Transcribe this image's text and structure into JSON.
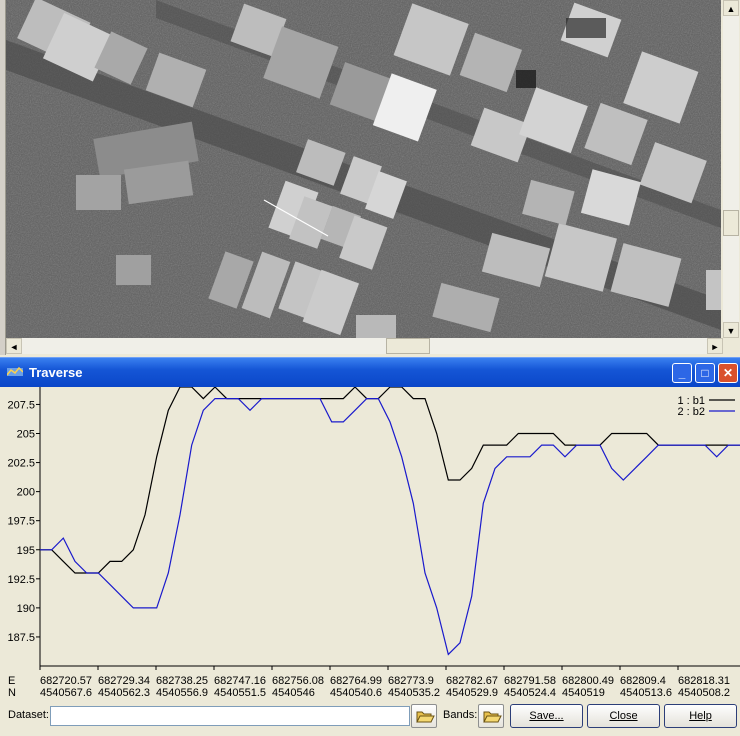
{
  "window": {
    "title": "Traverse",
    "minimize_label": "_",
    "maximize_label": "□",
    "close_label": "✕"
  },
  "image_viewer": {
    "icon_up": "▲",
    "icon_down": "▼",
    "icon_left": "◄",
    "icon_right": "►"
  },
  "legend": [
    {
      "label": "1 : b1",
      "color": "#000000"
    },
    {
      "label": "2 : b2",
      "color": "#1a1acc"
    }
  ],
  "chart_data": {
    "type": "line",
    "ylim": [
      185,
      209
    ],
    "y_ticks": [
      "207.5",
      "205",
      "202.5",
      "200",
      "197.5",
      "195",
      "192.5",
      "190",
      "187.5"
    ],
    "x_axis_rows": [
      "E",
      "N"
    ],
    "x_ticks": [
      {
        "e": "682720.57",
        "n": "4540567.6"
      },
      {
        "e": "682729.34",
        "n": "4540562.3"
      },
      {
        "e": "682738.25",
        "n": "4540556.9"
      },
      {
        "e": "682747.16",
        "n": "4540551.5"
      },
      {
        "e": "682756.08",
        "n": "4540546"
      },
      {
        "e": "682764.99",
        "n": "4540540.6"
      },
      {
        "e": "682773.9",
        "n": "4540535.2"
      },
      {
        "e": "682782.67",
        "n": "4540529.9"
      },
      {
        "e": "682791.58",
        "n": "4540524.4"
      },
      {
        "e": "682800.49",
        "n": "4540519"
      },
      {
        "e": "682809.4",
        "n": "4540513.6"
      },
      {
        "e": "682818.31",
        "n": "4540508.2"
      }
    ],
    "series": [
      {
        "name": "1 : b1",
        "x": [
          0,
          2,
          4,
          6,
          8,
          10,
          12,
          14,
          16,
          18,
          20,
          22,
          24,
          26,
          28,
          30,
          32,
          34,
          36,
          38,
          40,
          42,
          44,
          46,
          48,
          50,
          52,
          54,
          56,
          58,
          60,
          62,
          64,
          66,
          68,
          70,
          72,
          74,
          76,
          78,
          80,
          82,
          84,
          86,
          88,
          90,
          92,
          94,
          96,
          98,
          100,
          102,
          104,
          106,
          108,
          110,
          112,
          114,
          116,
          118,
          120
        ],
        "y": [
          195,
          195,
          194,
          193,
          193,
          193,
          194,
          194,
          195,
          198,
          203,
          207,
          209,
          209,
          208,
          209,
          208,
          208,
          208,
          208,
          208,
          208,
          208,
          208,
          208,
          208,
          208,
          209,
          208,
          208,
          209,
          209,
          208,
          208,
          205,
          201,
          201,
          202,
          204,
          204,
          204,
          205,
          205,
          205,
          205,
          204,
          204,
          204,
          204,
          205,
          205,
          205,
          205,
          204,
          204,
          204,
          204,
          204,
          204,
          204,
          204
        ]
      },
      {
        "name": "2 : b2",
        "x": [
          0,
          2,
          4,
          6,
          8,
          10,
          12,
          14,
          16,
          18,
          20,
          22,
          24,
          26,
          28,
          30,
          32,
          34,
          36,
          38,
          40,
          42,
          44,
          46,
          48,
          50,
          52,
          54,
          56,
          58,
          60,
          62,
          64,
          66,
          68,
          70,
          72,
          74,
          76,
          78,
          80,
          82,
          84,
          86,
          88,
          90,
          92,
          94,
          96,
          98,
          100,
          102,
          104,
          106,
          108,
          110,
          112,
          114,
          116,
          118,
          120
        ],
        "y": [
          195,
          195,
          196,
          194,
          193,
          193,
          192,
          191,
          190,
          190,
          190,
          193,
          198,
          204,
          207,
          208,
          208,
          208,
          207,
          208,
          208,
          208,
          208,
          208,
          208,
          206,
          206,
          207,
          208,
          208,
          206,
          203,
          199,
          193,
          190,
          186,
          187,
          191,
          199,
          202,
          203,
          203,
          203,
          204,
          204,
          203,
          204,
          204,
          204,
          202,
          201,
          202,
          203,
          204,
          204,
          204,
          204,
          204,
          203,
          204,
          204
        ]
      }
    ]
  },
  "bottom": {
    "dataset_label": "Dataset:",
    "dataset_value": "",
    "bands_label": "Bands:",
    "save_label": "Save...",
    "close_label": "Close",
    "help_label": "Help"
  }
}
